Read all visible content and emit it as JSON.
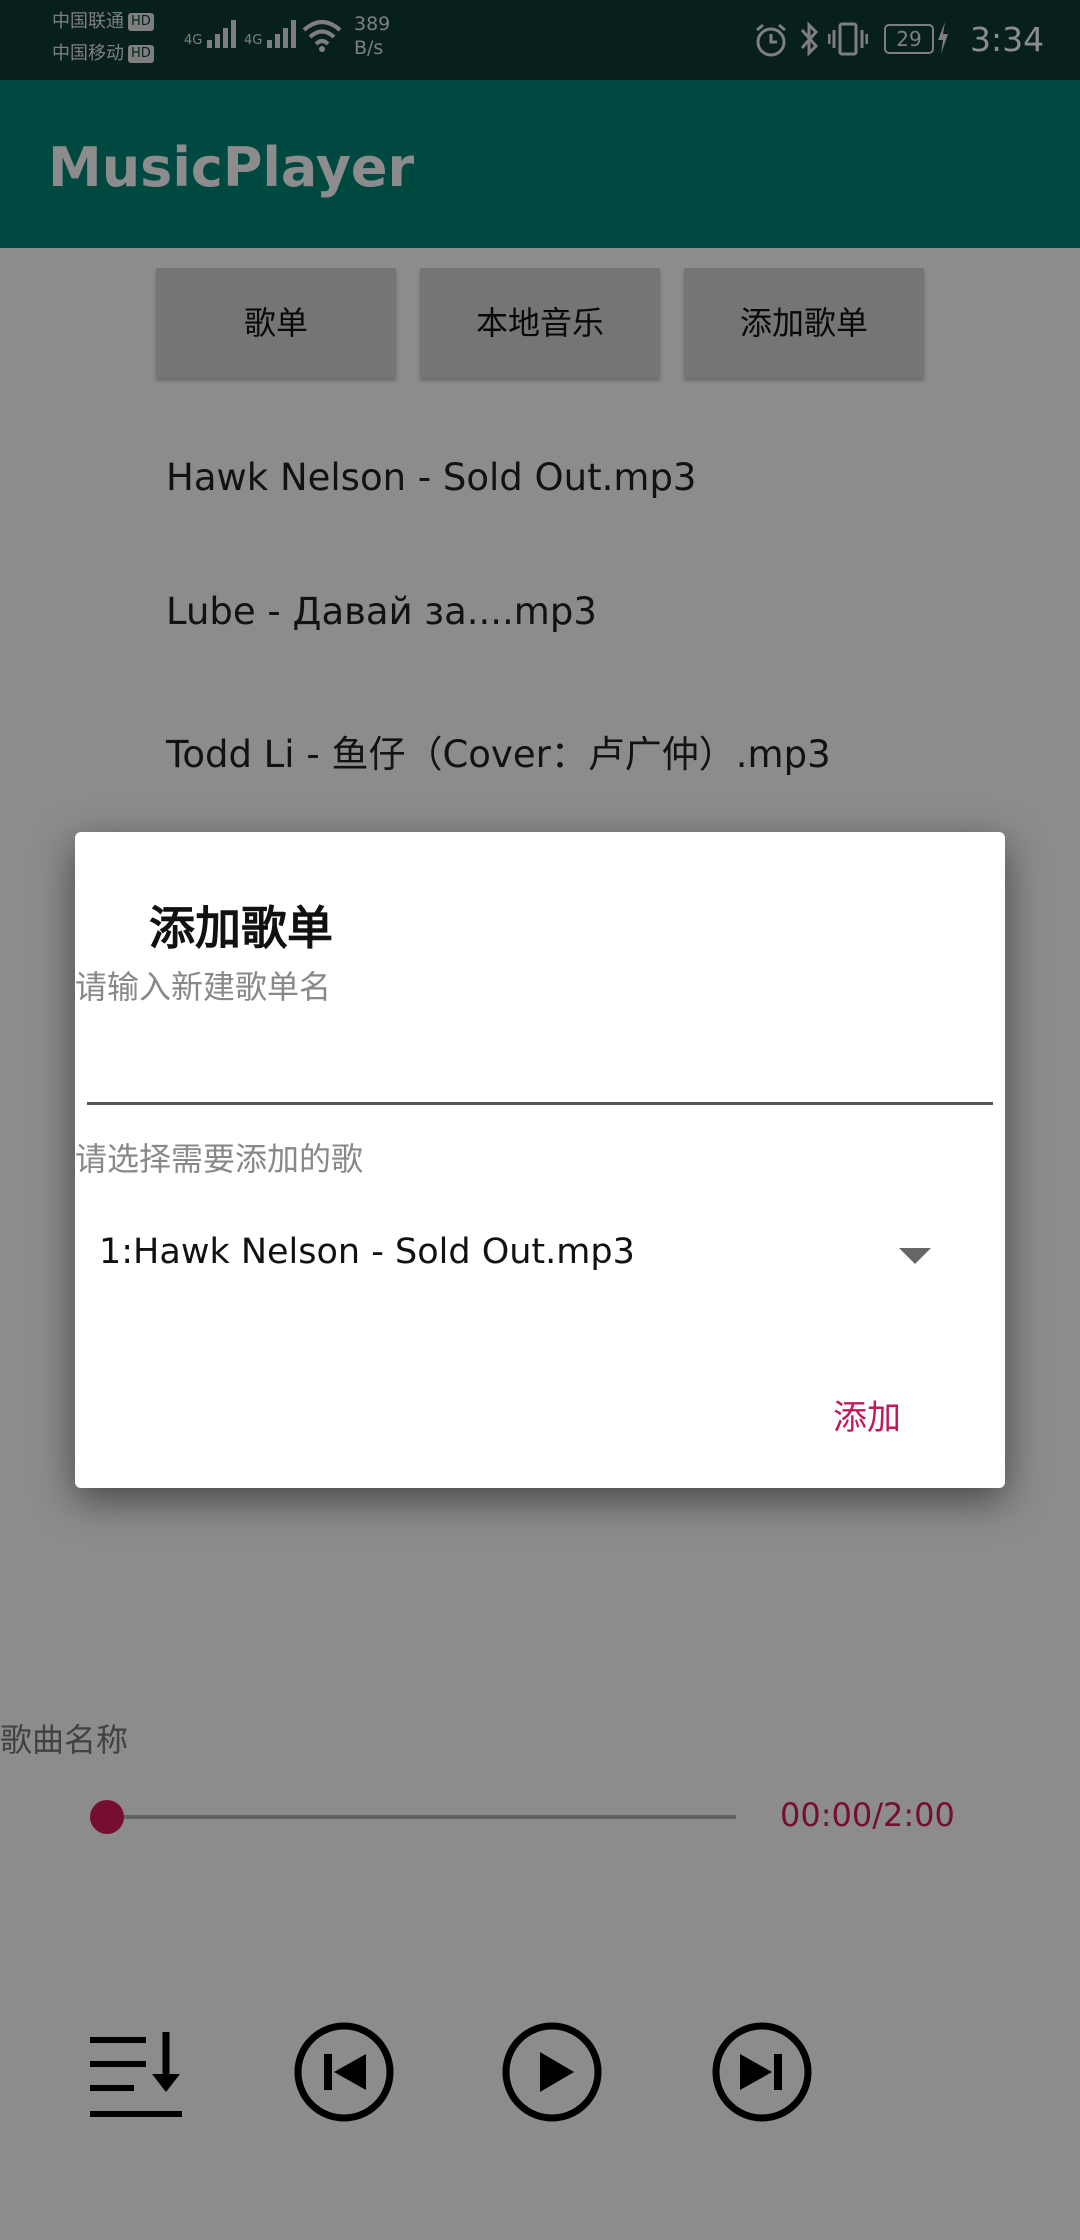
{
  "status_bar": {
    "carrier1": "中国联通",
    "carrier2": "中国移动",
    "hd": "HD",
    "net_type": "4G",
    "speed_value": "389",
    "speed_unit": "B/s",
    "battery": "29",
    "time": "3:34"
  },
  "app_bar": {
    "title": "MusicPlayer"
  },
  "tabs": [
    {
      "label": "歌单"
    },
    {
      "label": "本地音乐"
    },
    {
      "label": "添加歌单"
    }
  ],
  "songs": [
    {
      "title": "Hawk Nelson - Sold Out.mp3"
    },
    {
      "title": "Lube - Давай за....mp3"
    },
    {
      "title": "Todd Li - 鱼仔（Cover：卢广仲）.mp3"
    }
  ],
  "player": {
    "song_name_label": "歌曲名称",
    "time_text": "00:00/2:00",
    "progress": 0,
    "accent_color": "#d81b60"
  },
  "controls": [
    {
      "icon": "playlist-sort-icon"
    },
    {
      "icon": "skip-previous-icon"
    },
    {
      "icon": "play-icon"
    },
    {
      "icon": "skip-next-icon"
    }
  ],
  "dialog": {
    "title": "添加歌单",
    "name_hint": "请输入新建歌单名",
    "name_value": "",
    "select_hint": "请选择需要添加的歌",
    "selected_song": "1:Hawk Nelson - Sold Out.mp3",
    "add_label": "添加"
  },
  "colors": {
    "app_bar": "#008577",
    "status_bar": "#0d3b35",
    "accent": "#c2185b"
  }
}
